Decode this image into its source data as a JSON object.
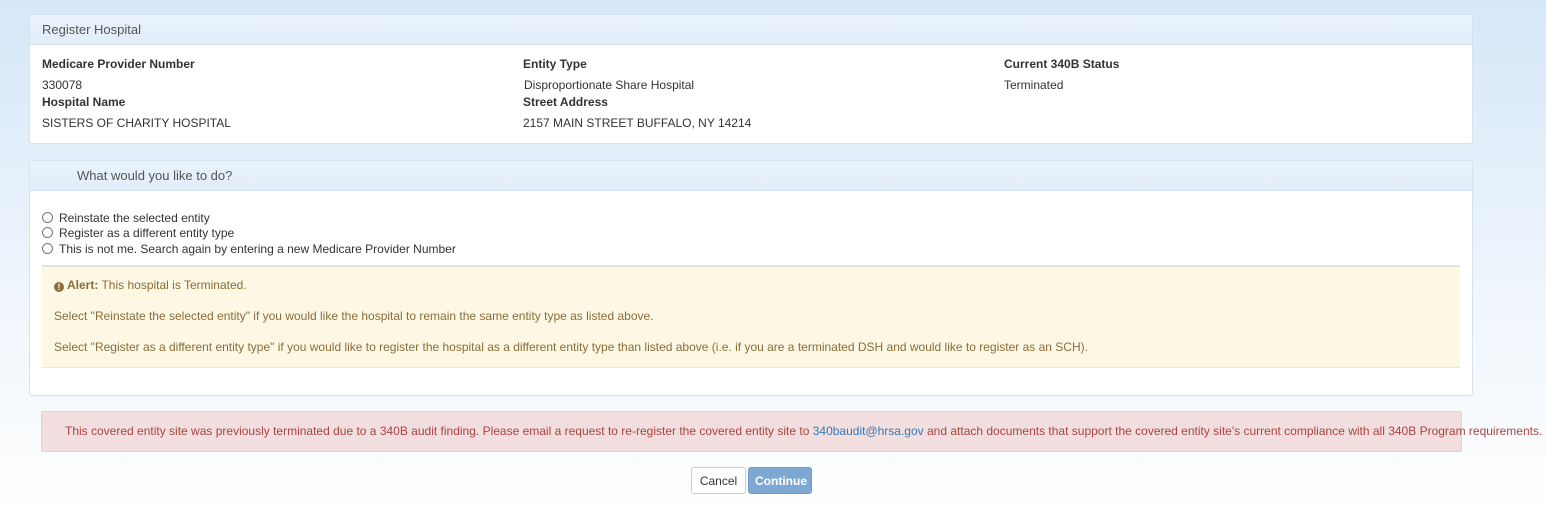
{
  "hospital_panel": {
    "title": "Register Hospital",
    "medicare_label": "Medicare Provider Number",
    "medicare_value": "330078",
    "entity_type_label": "Entity Type",
    "entity_type_value": "Disproportionate Share Hospital",
    "status_label": "Current 340B Status",
    "status_value": "Terminated",
    "hospital_name_label": "Hospital Name",
    "hospital_name_value": "SISTERS OF CHARITY HOSPITAL",
    "street_label": "Street Address",
    "street_value": "2157 MAIN STREET BUFFALO, NY 14214"
  },
  "action_panel": {
    "title": "What would you like to do?",
    "options": [
      "Reinstate the selected entity",
      "Register as a different entity type",
      "This is not me. Search again by entering a new Medicare Provider Number"
    ],
    "alert": {
      "icon": "exclamation-circle-icon",
      "label": "Alert:",
      "text": "This hospital is Terminated.",
      "line1": "Select \"Reinstate the selected entity\" if you would like the hospital to remain the same entity type as listed above.",
      "line2": "Select \"Register as a different entity type\" if you would like to register the hospital as a different entity type than listed above (i.e. if you are a terminated DSH and would like to register as an SCH)."
    }
  },
  "audit_notice": {
    "text_before": "This covered entity site was previously terminated due to a 340B audit finding. Please email a request to re-register the covered entity site to ",
    "email": "340baudit@hrsa.gov",
    "text_after": " and attach documents that support the covered entity site's current compliance with all 340B Program requirements."
  },
  "buttons": {
    "cancel": "Cancel",
    "continue": "Continue"
  },
  "colors": {
    "warning_text": "#8a6d3b",
    "danger_text": "#a94442",
    "link": "#337ab7",
    "primary_button": "#7ea8d3"
  }
}
